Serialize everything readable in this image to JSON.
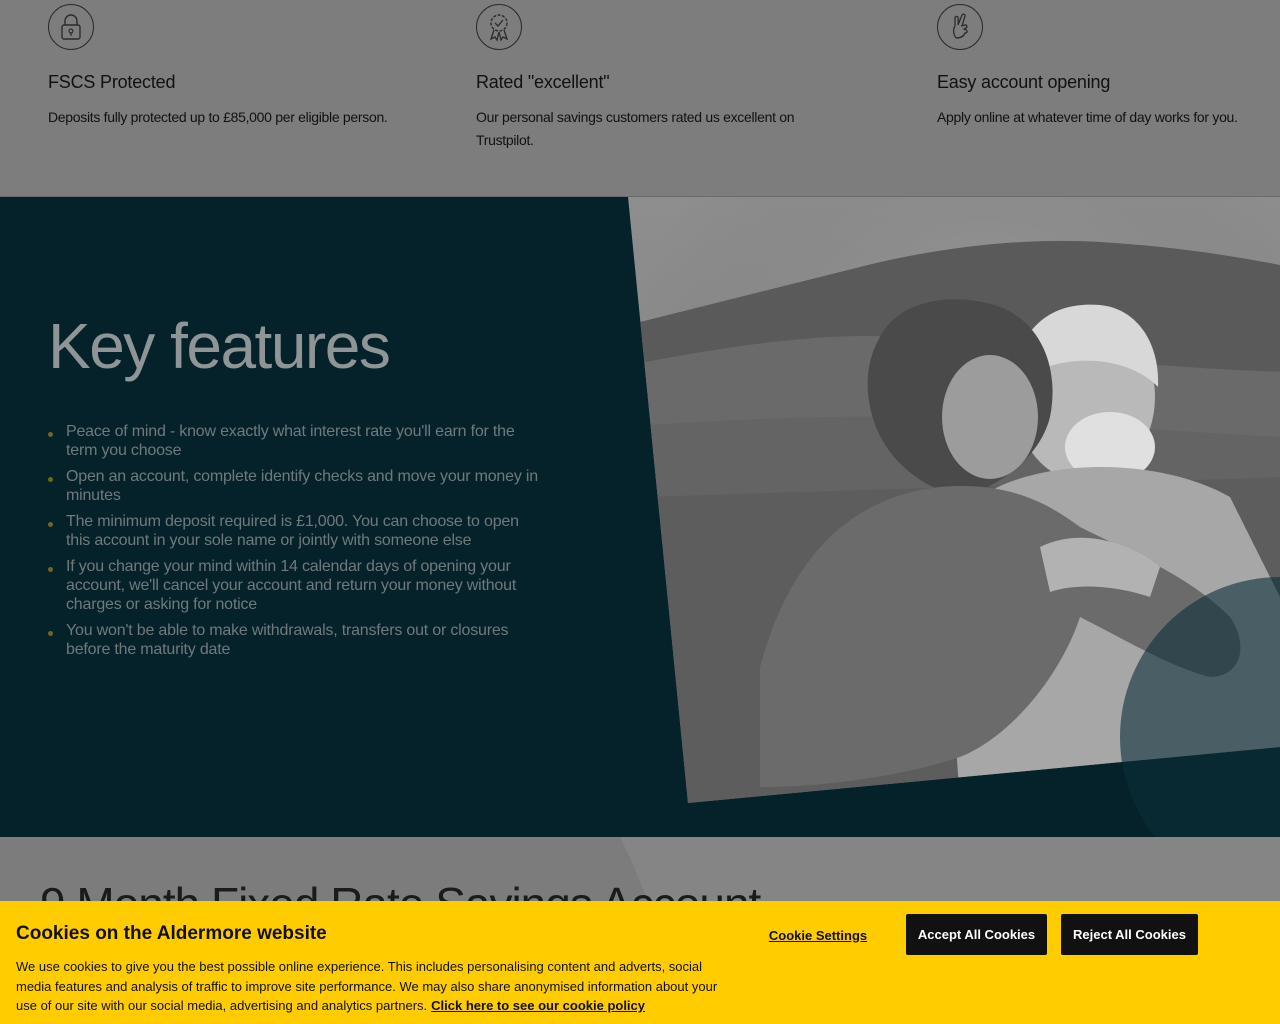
{
  "benefits": [
    {
      "icon": "padlock-icon",
      "title": "FSCS Protected",
      "text": "Deposits fully protected up to £85,000 per eligible person."
    },
    {
      "icon": "award-rosette-icon",
      "title": "Rated \"excellent\"",
      "text": "Our personal savings customers rated us excellent on Trustpilot."
    },
    {
      "icon": "fingers-crossed-icon",
      "title": "Easy account opening",
      "text": "Apply online at whatever time of day works for you."
    }
  ],
  "features": {
    "heading": "Key features",
    "items": [
      "Peace of mind - know exactly what interest rate you'll earn for the term you choose",
      "Open an account, complete identify checks and move your money in minutes",
      "The minimum deposit required is £1,000. You can choose to open this account in your sole name or jointly with someone else",
      "If you change your mind within 14 calendar days of opening your account, we'll cancel your account and return your money without charges or asking for notice",
      "You won't be able to make withdrawals, transfers out or closures before the maturity date"
    ]
  },
  "product": {
    "heading": "9 Month Fixed Rate Savings Account"
  },
  "cookie_banner": {
    "title": "Cookies on the Aldermore website",
    "text": "We use cookies to give you the best possible online experience. This includes personalising content and adverts, social media features and analysis of traffic to improve site performance. We may also share anonymised information about your use of our site with our social media, advertising and analytics partners.",
    "policy_link": "Click here to see our cookie policy",
    "settings_button": "Cookie Settings",
    "accept_button": "Accept All Cookies",
    "reject_button": "Reject All Cookies"
  },
  "colors": {
    "banner_bg": "#ffcc00",
    "features_bg": "#05212a",
    "overlay_grey": "#7c7c7c"
  }
}
